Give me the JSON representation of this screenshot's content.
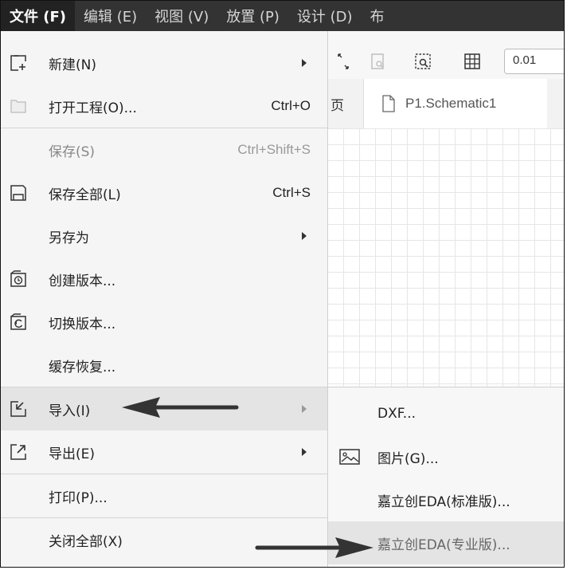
{
  "menubar": {
    "items": [
      {
        "label": "文件 (F)"
      },
      {
        "label": "编辑 (E)"
      },
      {
        "label": "视图 (V)"
      },
      {
        "label": "放置 (P)"
      },
      {
        "label": "设计 (D)"
      },
      {
        "label": "布"
      }
    ]
  },
  "toolbar": {
    "zoom_value": "0.01"
  },
  "tabs": {
    "previous_tab_fragment": "页",
    "active_tab": "P1.Schematic1"
  },
  "file_menu": {
    "items": [
      {
        "label": "新建(N)",
        "shortcut": "",
        "icon": "new-file-icon"
      },
      {
        "label": "打开工程(O)...",
        "shortcut": "Ctrl+O",
        "icon": "folder-icon"
      },
      {
        "label": "保存(S)",
        "shortcut": "Ctrl+Shift+S",
        "icon": ""
      },
      {
        "label": "保存全部(L)",
        "shortcut": "Ctrl+S",
        "icon": "save-all-icon"
      },
      {
        "label": "另存为",
        "shortcut": "",
        "icon": ""
      },
      {
        "label": "创建版本...",
        "shortcut": "",
        "icon": "create-version-icon"
      },
      {
        "label": "切换版本...",
        "shortcut": "",
        "icon": "switch-version-icon"
      },
      {
        "label": "缓存恢复...",
        "shortcut": "",
        "icon": ""
      },
      {
        "label": "导入(I)",
        "shortcut": "",
        "icon": "import-icon"
      },
      {
        "label": "导出(E)",
        "shortcut": "",
        "icon": "export-icon"
      },
      {
        "label": "打印(P)...",
        "shortcut": "",
        "icon": ""
      },
      {
        "label": "关闭全部(X)",
        "shortcut": "",
        "icon": ""
      }
    ]
  },
  "import_submenu": {
    "items": [
      {
        "label": "DXF...",
        "icon": ""
      },
      {
        "label": "图片(G)...",
        "icon": "image-icon"
      },
      {
        "label": "嘉立创EDA(标准版)...",
        "icon": ""
      },
      {
        "label": "嘉立创EDA(专业版)...",
        "icon": ""
      }
    ]
  },
  "colors": {
    "menubar_bg": "#333333",
    "menu_bg": "#f5f5f5",
    "hover_bg": "#e4e4e4",
    "annotation_arrow": "#333333"
  }
}
